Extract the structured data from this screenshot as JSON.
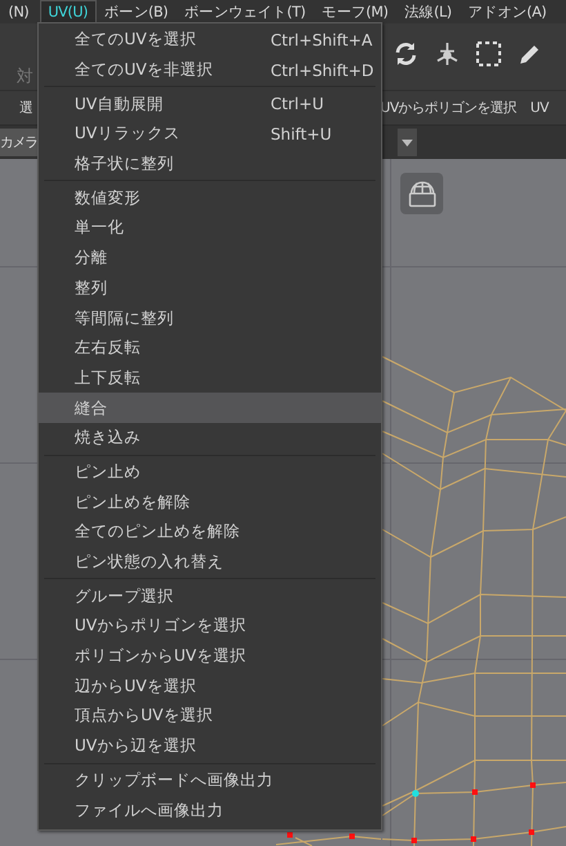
{
  "menubar": [
    {
      "label": "(N)",
      "selected": false
    },
    {
      "label": "UV(U)",
      "selected": true
    },
    {
      "label": "ボーン(B)",
      "selected": false
    },
    {
      "label": "ボーンウェイト(T)",
      "selected": false
    },
    {
      "label": "モーフ(M)",
      "selected": false
    },
    {
      "label": "法線(L)",
      "selected": false
    },
    {
      "label": "アドオン(A)",
      "selected": false
    }
  ],
  "toolbar": {
    "symmetry_label": "対",
    "select_label": "選",
    "uv_poly_button": "UVからポリゴンを選択",
    "uv_button": "UV",
    "camera_label": "カメラ"
  },
  "menu": {
    "sections": [
      [
        {
          "label": "全てのUVを選択",
          "shortcut": "Ctrl+Shift+A",
          "selected": false
        },
        {
          "label": "全てのUVを非選択",
          "shortcut": "Ctrl+Shift+D",
          "selected": false
        }
      ],
      [
        {
          "label": "UV自動展開",
          "shortcut": "Ctrl+U",
          "selected": false
        },
        {
          "label": "UVリラックス",
          "shortcut": "Shift+U",
          "selected": false
        },
        {
          "label": "格子状に整列",
          "selected": false
        }
      ],
      [
        {
          "label": "数値変形",
          "selected": false
        },
        {
          "label": "単一化",
          "selected": false
        },
        {
          "label": "分離",
          "selected": false
        },
        {
          "label": "整列",
          "selected": false
        },
        {
          "label": "等間隔に整列",
          "selected": false
        },
        {
          "label": "左右反転",
          "selected": false
        },
        {
          "label": "上下反転",
          "selected": false
        },
        {
          "label": "縫合",
          "selected": true
        },
        {
          "label": "焼き込み",
          "selected": false
        }
      ],
      [
        {
          "label": "ピン止め",
          "selected": false
        },
        {
          "label": "ピン止めを解除",
          "selected": false
        },
        {
          "label": "全てのピン止めを解除",
          "selected": false
        },
        {
          "label": "ピン状態の入れ替え",
          "selected": false
        }
      ],
      [
        {
          "label": "グループ選択",
          "selected": false
        },
        {
          "label": "UVからポリゴンを選択",
          "selected": false
        },
        {
          "label": "ポリゴンからUVを選択",
          "selected": false
        },
        {
          "label": "辺からUVを選択",
          "selected": false
        },
        {
          "label": "頂点からUVを選択",
          "selected": false
        },
        {
          "label": "UVから辺を選択",
          "selected": false
        }
      ],
      [
        {
          "label": "クリップボードへ画像出力",
          "selected": false
        },
        {
          "label": "ファイルへ画像出力",
          "selected": false
        }
      ]
    ]
  }
}
